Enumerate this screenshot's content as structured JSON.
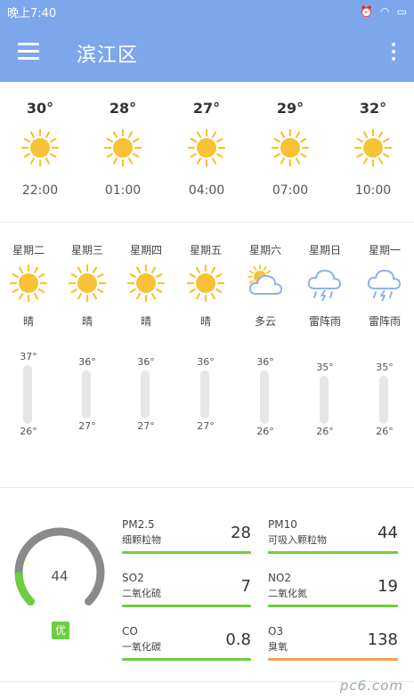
{
  "status_bar": {
    "time": "晚上7:40",
    "icons": [
      "alarm-icon",
      "wifi-icon",
      "battery-icon"
    ]
  },
  "app_bar": {
    "title": "滨江区"
  },
  "hourly": [
    {
      "temp": "30°",
      "time": "22:00",
      "icon": "sun-icon"
    },
    {
      "temp": "28°",
      "time": "01:00",
      "icon": "sun-icon"
    },
    {
      "temp": "27°",
      "time": "04:00",
      "icon": "sun-icon"
    },
    {
      "temp": "29°",
      "time": "07:00",
      "icon": "sun-icon"
    },
    {
      "temp": "32°",
      "time": "10:00",
      "icon": "sun-icon"
    }
  ],
  "daily": [
    {
      "day": "星期二",
      "weather": "晴",
      "icon": "sun-icon",
      "high": "37°",
      "low": "26°",
      "high_value": 37,
      "low_value": 26
    },
    {
      "day": "星期三",
      "weather": "晴",
      "icon": "sun-icon",
      "high": "36°",
      "low": "27°",
      "high_value": 36,
      "low_value": 27
    },
    {
      "day": "星期四",
      "weather": "晴",
      "icon": "sun-icon",
      "high": "36°",
      "low": "27°",
      "high_value": 36,
      "low_value": 27
    },
    {
      "day": "星期五",
      "weather": "晴",
      "icon": "sun-icon",
      "high": "36°",
      "low": "27°",
      "high_value": 36,
      "low_value": 27
    },
    {
      "day": "星期六",
      "weather": "多云",
      "icon": "partly-cloudy-icon",
      "high": "36°",
      "low": "26°",
      "high_value": 36,
      "low_value": 26
    },
    {
      "day": "星期日",
      "weather": "雷阵雨",
      "icon": "thunderstorm-icon",
      "high": "35°",
      "low": "26°",
      "high_value": 35,
      "low_value": 26
    },
    {
      "day": "星期一",
      "weather": "雷阵雨",
      "icon": "thunderstorm-icon",
      "high": "35°",
      "low": "26°",
      "high_value": 35,
      "low_value": 26
    }
  ],
  "air_quality": {
    "aqi": "44",
    "aqi_level": 0.15,
    "level_label": "优",
    "level_color": "#6fcd3f",
    "pollutants": [
      {
        "name": "PM2.5",
        "label": "细颗粒物",
        "value": "28",
        "color": "#6fcd3f"
      },
      {
        "name": "PM10",
        "label": "可吸入颗粒物",
        "value": "44",
        "color": "#6fcd3f"
      },
      {
        "name": "SO2",
        "label": "二氧化硫",
        "value": "7",
        "color": "#6fcd3f"
      },
      {
        "name": "NO2",
        "label": "二氧化氮",
        "value": "19",
        "color": "#6fcd3f"
      },
      {
        "name": "CO",
        "label": "一氧化碳",
        "value": "0.8",
        "color": "#6fcd3f"
      },
      {
        "name": "O3",
        "label": "臭氧",
        "value": "138",
        "color": "#f0a24a"
      }
    ]
  },
  "watermark": "pc6.com",
  "colors": {
    "accent": "#7da7ec",
    "sun": "#f7c236",
    "cloud": "#90b4e0"
  }
}
